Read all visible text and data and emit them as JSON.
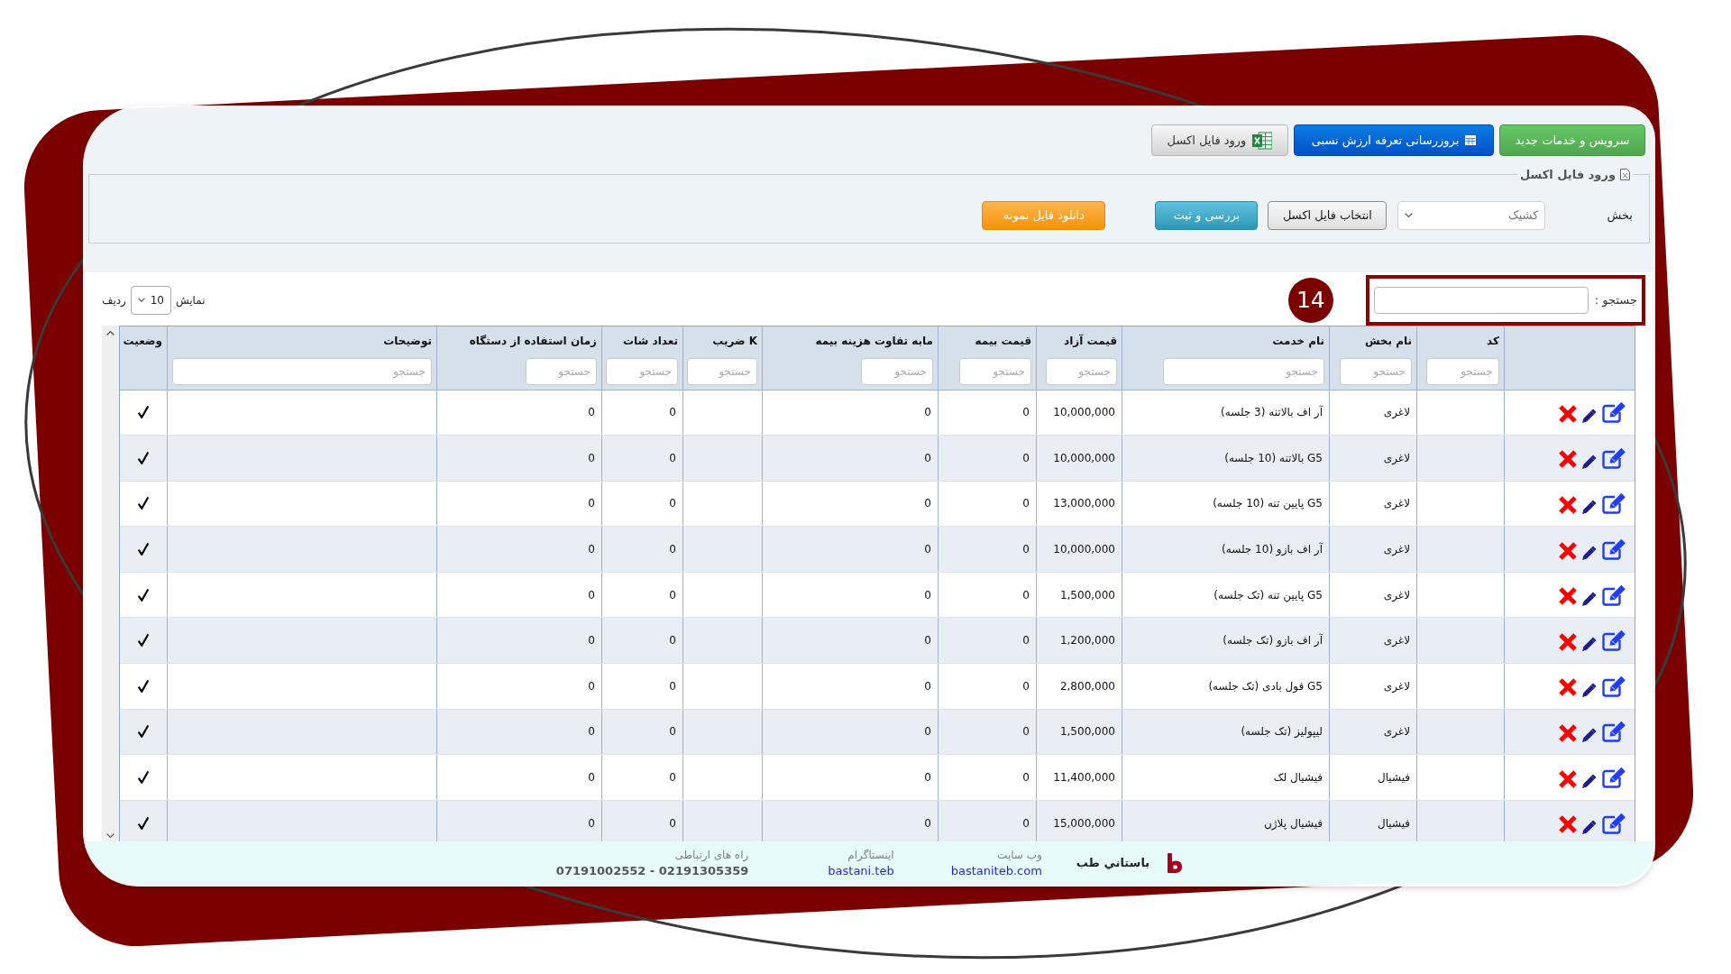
{
  "toolbar": {
    "buttons": [
      {
        "kind": "success",
        "label": "سرویس و خدمات جدید"
      },
      {
        "kind": "primary",
        "label": "بروزرسانی تعرفه ارزش نسبی"
      },
      {
        "kind": "excel",
        "label": "ورود فایل اکسل"
      }
    ]
  },
  "excel_import": {
    "legend": "ورود فایل اکسل",
    "section_label": "بخش",
    "section_select": {
      "value": "کشیک"
    },
    "buttons": [
      {
        "kind": "default",
        "label": "انتخاب فایل اکسل"
      },
      {
        "kind": "info",
        "label": "بررسی و ثبت"
      },
      {
        "kind": "warning",
        "label": "دانلود فایل نمونه"
      }
    ]
  },
  "search": {
    "label": "جستجو :",
    "highlighted": true
  },
  "badge": "14",
  "page_length": {
    "label_before": "نمایش",
    "value": "10",
    "label_after": "ردیف"
  },
  "table": {
    "columns": [
      {
        "kind": "text",
        "label": "کد",
        "placeholder": "جستجو"
      },
      {
        "kind": "text",
        "label": "نام بخش",
        "placeholder": "جستجو"
      },
      {
        "kind": "text",
        "label": "نام خدمت",
        "placeholder": "جستجو"
      },
      {
        "kind": "text",
        "label": "قیمت آزاد",
        "placeholder": "جستجو"
      },
      {
        "kind": "text",
        "label": "قیمت بیمه",
        "placeholder": "جستجو"
      },
      {
        "kind": "text",
        "label": "مابه تفاوت هزینه بیمه",
        "placeholder": "جستجو"
      },
      {
        "kind": "text",
        "label": "K ضریب",
        "placeholder": "جستجو"
      },
      {
        "kind": "text",
        "label": "تعداد شات",
        "placeholder": "جستجو"
      },
      {
        "kind": "text",
        "label": "زمان استفاده از دستگاه",
        "placeholder": "جستجو"
      },
      {
        "kind": "text",
        "label": "توضیحات",
        "placeholder": "جستجو"
      },
      {
        "kind": "status",
        "label": "وضعیت"
      }
    ],
    "rows": [
      {
        "section": "لاغری",
        "service": "آر اف بالاتنه (3 جلسه)",
        "price_free": "10,000,000",
        "price_insurance": "0",
        "insurance_difference": "0",
        "shot_count": "0",
        "usage_time": "0",
        "active": true
      },
      {
        "section": "لاغری",
        "service": "G5 بالاتنه (10 جلسه)",
        "price_free": "10,000,000",
        "price_insurance": "0",
        "insurance_difference": "0",
        "shot_count": "0",
        "usage_time": "0",
        "active": true
      },
      {
        "section": "لاغری",
        "service": "G5 پایین تنه (10 جلسه)",
        "price_free": "13,000,000",
        "price_insurance": "0",
        "insurance_difference": "0",
        "shot_count": "0",
        "usage_time": "0",
        "active": true
      },
      {
        "section": "لاغری",
        "service": "آر اف بازو (10 جلسه)",
        "price_free": "10,000,000",
        "price_insurance": "0",
        "insurance_difference": "0",
        "shot_count": "0",
        "usage_time": "0",
        "active": true
      },
      {
        "section": "لاغری",
        "service": "G5 پایین تنه (تک جلسه)",
        "price_free": "1,500,000",
        "price_insurance": "0",
        "insurance_difference": "0",
        "shot_count": "0",
        "usage_time": "0",
        "active": true
      },
      {
        "section": "لاغری",
        "service": "آر اف بازو (تک جلسه)",
        "price_free": "1,200,000",
        "price_insurance": "0",
        "insurance_difference": "0",
        "shot_count": "0",
        "usage_time": "0",
        "active": true
      },
      {
        "section": "لاغری",
        "service": "G5 فول بادی (تک جلسه)",
        "price_free": "2,800,000",
        "price_insurance": "0",
        "insurance_difference": "0",
        "shot_count": "0",
        "usage_time": "0",
        "active": true
      },
      {
        "section": "لاغری",
        "service": "لیپولیز (تک جلسه)",
        "price_free": "1,500,000",
        "price_insurance": "0",
        "insurance_difference": "0",
        "shot_count": "0",
        "usage_time": "0",
        "active": true
      },
      {
        "section": "فیشیال",
        "service": "فیشیال لک",
        "price_free": "11,400,000",
        "price_insurance": "0",
        "insurance_difference": "0",
        "shot_count": "0",
        "usage_time": "0",
        "active": true
      },
      {
        "section": "فیشیال",
        "service": "فیشیال پلاژن",
        "price_free": "15,000,000",
        "price_insurance": "0",
        "insurance_difference": "0",
        "shot_count": "0",
        "usage_time": "0",
        "active": true
      }
    ]
  },
  "footer": {
    "brand": "باستاني طب",
    "items": [
      {
        "kind": "link",
        "label": "وب سایت",
        "value": "bastaniteb.com"
      },
      {
        "kind": "link",
        "label": "اینستاگرام",
        "value": "bastani.teb"
      },
      {
        "kind": "phone",
        "label": "راه های ارتباطی",
        "value": "07191002552 - 02191305359"
      }
    ]
  }
}
